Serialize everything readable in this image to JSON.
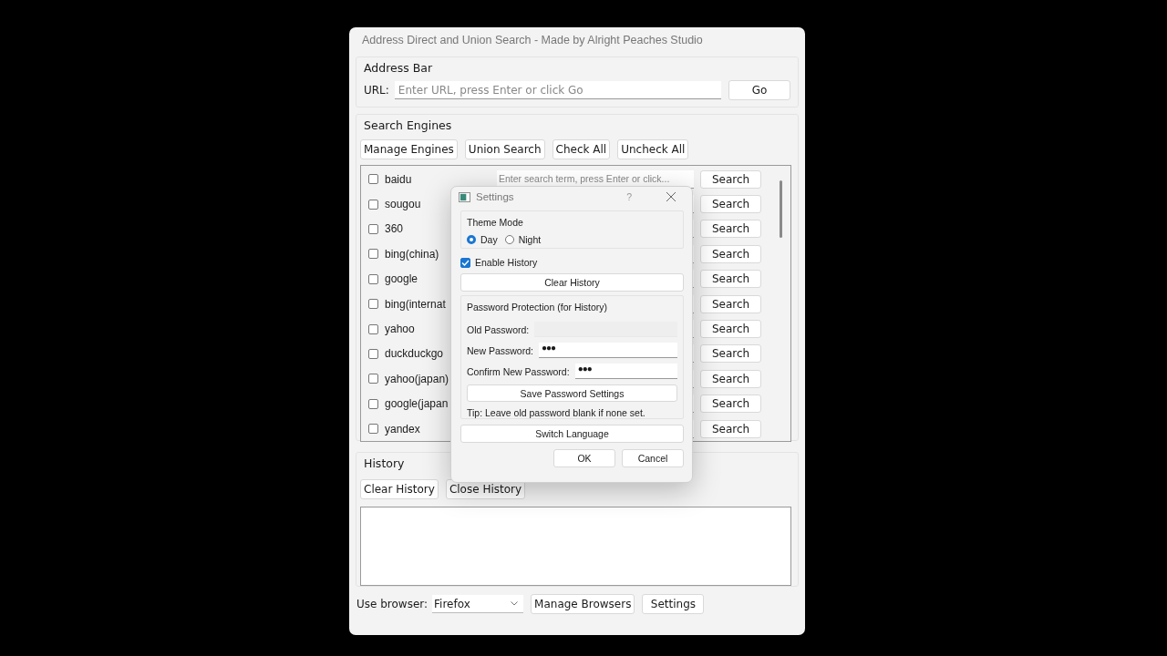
{
  "window": {
    "title": "Address Direct and Union Search - Made by Alright Peaches Studio"
  },
  "address_bar": {
    "title": "Address Bar",
    "label": "URL:",
    "placeholder": "Enter URL, press Enter or click Go",
    "button": "Go"
  },
  "search_engines": {
    "title": "Search Engines",
    "buttons": [
      "Manage Engines",
      "Union Search",
      "Check All",
      "Uncheck All"
    ],
    "engines": [
      {
        "name": "baidu",
        "checked": false,
        "placeholder": "Enter search term, press Enter or click...",
        "button": "Search"
      },
      {
        "name": "sougou",
        "checked": false,
        "button": "Search"
      },
      {
        "name": "360",
        "checked": false,
        "button": "Search"
      },
      {
        "name": "bing(china)",
        "checked": false,
        "button": "Search"
      },
      {
        "name": "google",
        "checked": false,
        "button": "Search"
      },
      {
        "name": "bing(internat",
        "checked": false,
        "button": "Search"
      },
      {
        "name": "yahoo",
        "checked": false,
        "button": "Search"
      },
      {
        "name": "duckduckgo",
        "checked": false,
        "button": "Search"
      },
      {
        "name": "yahoo(japan)",
        "checked": false,
        "button": "Search"
      },
      {
        "name": "google(japan",
        "checked": false,
        "button": "Search"
      },
      {
        "name": "yandex",
        "checked": false,
        "button": "Search"
      }
    ]
  },
  "history": {
    "title": "History",
    "buttons": [
      "Clear History",
      "Close History"
    ]
  },
  "footer": {
    "label": "Use browser:",
    "browser": "Firefox",
    "buttons": [
      "Manage Browsers",
      "Settings"
    ]
  },
  "settings_dialog": {
    "title": "Settings",
    "help": "?",
    "theme": {
      "title": "Theme Mode",
      "options": [
        {
          "label": "Day",
          "selected": true
        },
        {
          "label": "Night",
          "selected": false
        }
      ]
    },
    "enable_history": {
      "label": "Enable History",
      "checked": true
    },
    "clear_history": "Clear History",
    "password": {
      "title": "Password Protection (for History)",
      "fields": [
        {
          "label": "Old Password:"
        },
        {
          "label": "New Password:",
          "value": "●●●"
        },
        {
          "label": "Confirm New Password:",
          "value": "●●●"
        }
      ],
      "save": "Save Password Settings",
      "tip": "Tip: Leave old password blank if none set."
    },
    "switch_language": "Switch Language",
    "buttons": [
      "OK",
      "Cancel"
    ]
  }
}
